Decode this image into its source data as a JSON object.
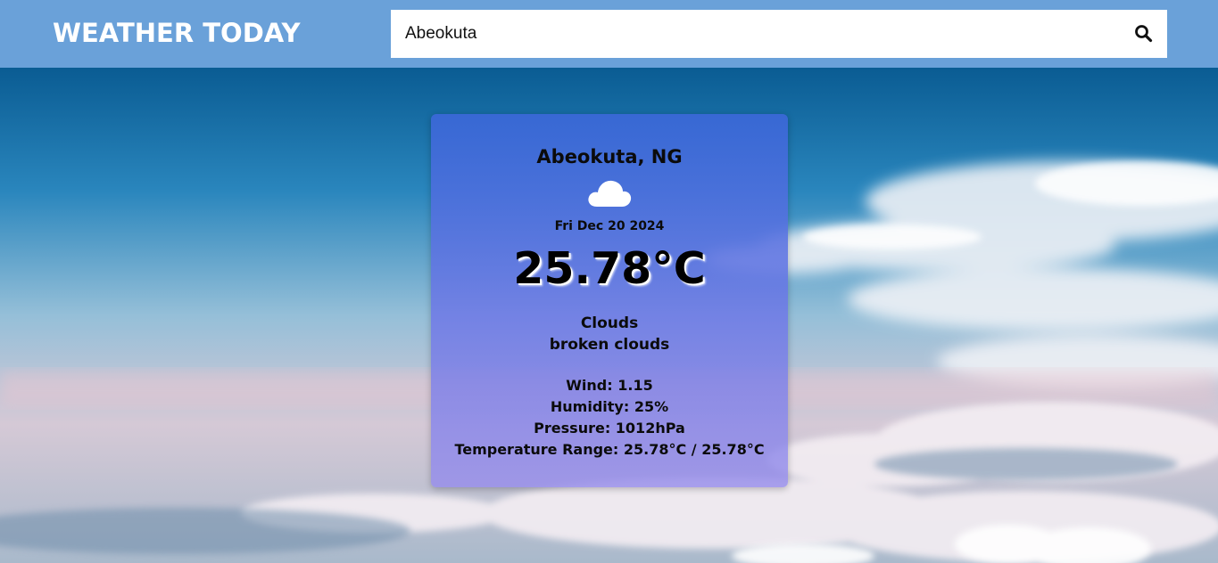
{
  "header": {
    "brand": "WEATHER TODAY",
    "search_value": "Abeokuta",
    "search_icon": "search-icon"
  },
  "card": {
    "location": "Abeokuta, NG",
    "icon": "cloud-icon",
    "date": "Fri Dec 20 2024",
    "temperature": "25.78°C",
    "condition": "Clouds",
    "description": "broken clouds",
    "wind": "Wind: 1.15",
    "humidity": "Humidity: 25%",
    "pressure": "Pressure: 1012hPa",
    "temp_range": "Temperature Range: 25.78°C / 25.78°C"
  },
  "colors": {
    "header_bg": "#6aa1d9",
    "card_top": "#3a68d8",
    "card_bottom": "#968ceb"
  }
}
